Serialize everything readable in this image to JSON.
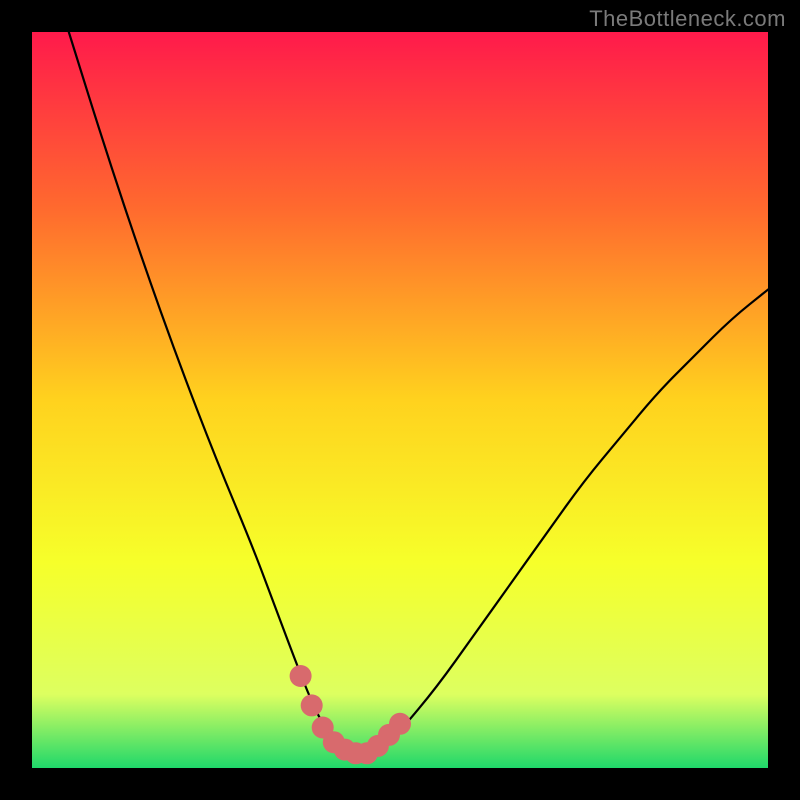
{
  "watermark": "TheBottleneck.com",
  "chart_data": {
    "type": "line",
    "title": "",
    "xlabel": "",
    "ylabel": "",
    "xlim": [
      0,
      100
    ],
    "ylim": [
      0,
      100
    ],
    "grid": false,
    "legend": false,
    "series": [
      {
        "name": "bottleneck-curve",
        "x": [
          5,
          10,
          15,
          20,
          25,
          30,
          33,
          36,
          38,
          40,
          42,
          44,
          46,
          48,
          50,
          55,
          60,
          65,
          70,
          75,
          80,
          85,
          90,
          95,
          100
        ],
        "values": [
          100,
          84,
          69,
          55,
          42,
          30,
          22,
          14,
          9,
          5,
          3,
          2,
          2,
          3,
          5,
          11,
          18,
          25,
          32,
          39,
          45,
          51,
          56,
          61,
          65
        ]
      }
    ],
    "highlight": {
      "name": "minimum-band",
      "x": [
        36.5,
        38,
        39.5,
        41,
        42.5,
        44,
        45.5,
        47,
        48.5,
        50
      ],
      "values": [
        12.5,
        8.5,
        5.5,
        3.5,
        2.5,
        2,
        2,
        3,
        4.5,
        6
      ]
    },
    "gradient_colors": {
      "top": "#ff1a4b",
      "upper_mid": "#ff6a2e",
      "mid": "#ffd21e",
      "lower_mid": "#f6ff2a",
      "low": "#ddff60",
      "bottom": "#1fd86a"
    }
  }
}
